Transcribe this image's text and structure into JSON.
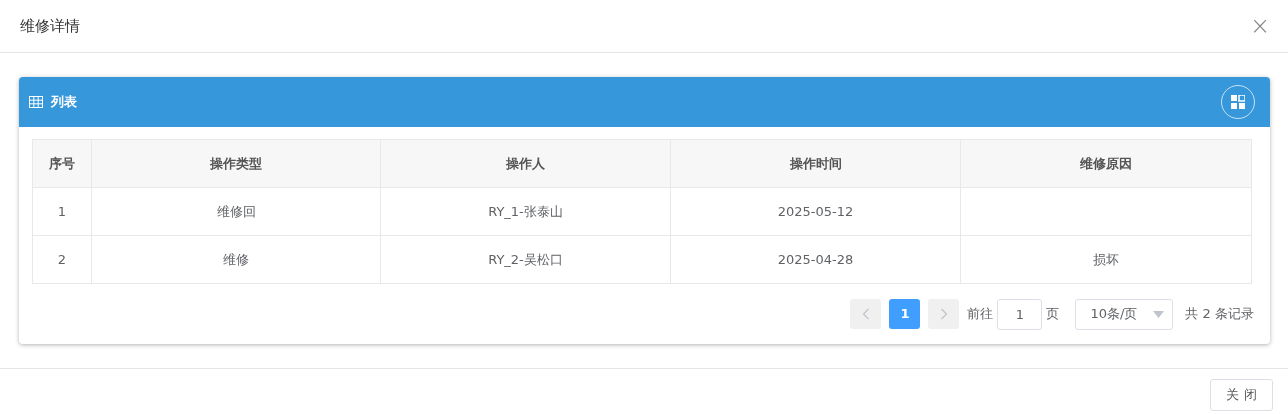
{
  "dialog": {
    "title": "维修详情",
    "close_icon": "×"
  },
  "panel": {
    "title": "列表"
  },
  "table": {
    "columns": [
      "序号",
      "操作类型",
      "操作人",
      "操作时间",
      "维修原因"
    ],
    "rows": [
      {
        "index": "1",
        "type": "维修回",
        "operator": "RY_1-张泰山",
        "time": "2025-05-12"
      },
      {
        "index": "2",
        "type": "维修",
        "operator": "RY_2-吴松口",
        "time": "2025-04-28",
        "reason": "损坏"
      }
    ]
  },
  "pagination": {
    "prev": {
      "disabled": true
    },
    "pages": [
      {
        "label": "1",
        "selected": true
      }
    ],
    "next": {
      "disabled": true
    },
    "goto_label": "前往",
    "goto_value": "1",
    "goto_suffix": "页",
    "page_size": "10条/页",
    "total": "共 2 条记录"
  },
  "footer": {
    "close_button": "关 闭"
  }
}
